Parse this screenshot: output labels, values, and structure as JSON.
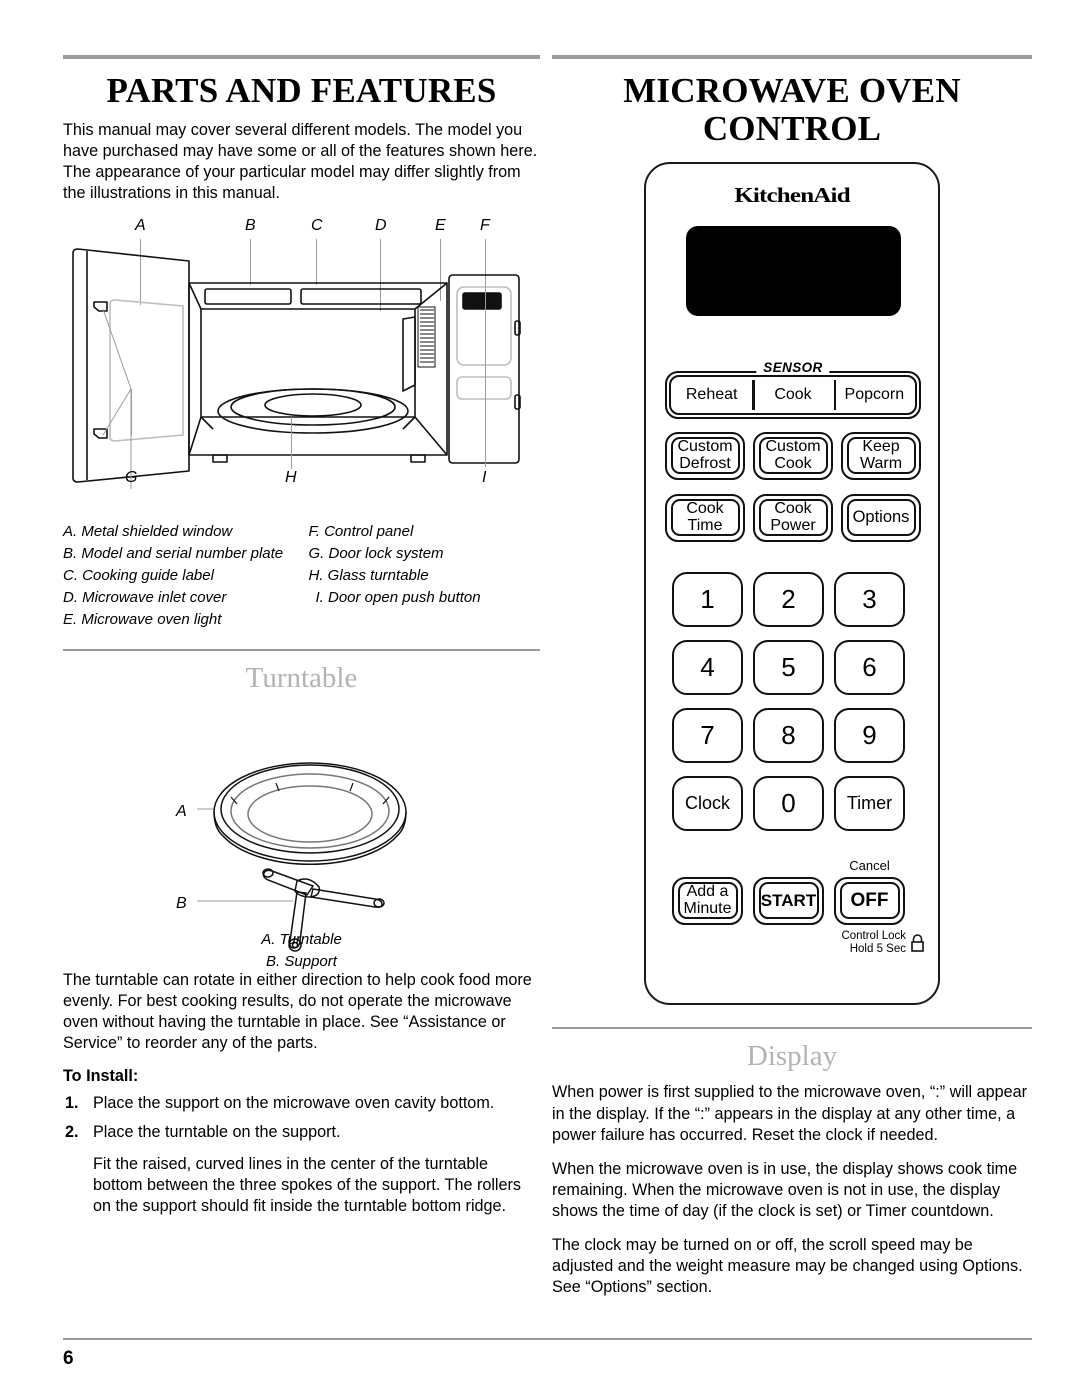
{
  "page": {
    "number": "6"
  },
  "left_column": {
    "title": "PARTS AND FEATURES",
    "intro": "This manual may cover several different models. The model you have purchased may have some or all of the features shown here. The appearance of your particular model may differ slightly from the illustrations in this manual.",
    "diagram_letters_top": [
      "A",
      "B",
      "C",
      "D",
      "E",
      "F"
    ],
    "diagram_letters_bottom": [
      "G",
      "H",
      "I"
    ],
    "legend_left": [
      "A. Metal shielded window",
      "B. Model and serial number plate",
      "C. Cooking guide label",
      "D. Microwave inlet cover",
      "E. Microwave oven light"
    ],
    "legend_right": [
      "F. Control panel",
      "G. Door lock system",
      "H. Glass turntable",
      "I. Door open push button"
    ],
    "turntable": {
      "heading": "Turntable",
      "letters": [
        "A",
        "B"
      ],
      "caption": [
        "A. Turntable",
        "B. Support"
      ],
      "paragraph": "The turntable can rotate in either direction to help cook food more evenly. For best cooking results, do not operate the microwave oven without having the turntable in place. See “Assistance or Service” to reorder any of the parts.",
      "install_heading": "To Install:",
      "steps": [
        {
          "num": "1.",
          "text": "Place the support on the microwave oven cavity bottom."
        },
        {
          "num": "2.",
          "text": "Place the turntable on the support."
        }
      ],
      "step_note": "Fit the raised, curved lines in the center of the turntable bottom between the three spokes of the support. The rollers on the support should fit inside the turntable bottom ridge."
    }
  },
  "right_column": {
    "title": "MICROWAVE OVEN CONTROL",
    "control_panel": {
      "brand": "KitchenAid",
      "sensor_label": "SENSOR",
      "sensor_buttons": [
        "Reheat",
        "Cook",
        "Popcorn"
      ],
      "function_rows": [
        [
          {
            "lines": [
              "Custom",
              "Defrost"
            ]
          },
          {
            "lines": [
              "Custom",
              "Cook"
            ]
          },
          {
            "lines": [
              "Keep",
              "Warm"
            ]
          }
        ],
        [
          {
            "lines": [
              "Cook",
              "Time"
            ]
          },
          {
            "lines": [
              "Cook",
              "Power"
            ]
          },
          {
            "lines": [
              "Options"
            ]
          }
        ]
      ],
      "keypad": [
        [
          "1",
          "2",
          "3"
        ],
        [
          "4",
          "5",
          "6"
        ],
        [
          "7",
          "8",
          "9"
        ],
        [
          "Clock",
          "0",
          "Timer"
        ]
      ],
      "bottom_row": [
        "Add a Minute",
        "START",
        "OFF"
      ],
      "add_minute_lines": [
        "Add a",
        "Minute"
      ],
      "start_label": "START",
      "off_label": "OFF",
      "cancel_label": "Cancel",
      "control_lock_line1": "Control Lock",
      "control_lock_line2": "Hold 5 Sec",
      "lock_icon": "padlock-icon"
    },
    "display": {
      "heading": "Display",
      "paragraphs": [
        "When power is first supplied to the microwave oven, “:” will appear in the display. If the “:” appears in the display at any other time, a power failure has occurred. Reset the clock if needed.",
        "When the microwave oven is in use, the display shows cook time remaining. When the microwave oven is not in use, the display shows the time of day (if the clock is set) or Timer countdown.",
        "The clock may be turned on or off, the scroll speed may be adjusted and the weight measure may be changed using Options. See “Options” section."
      ]
    }
  },
  "colors": {
    "rule_gray": "#9a9a9a",
    "heading_gray": "#b3b3b3",
    "ink": "#111111",
    "display_black": "#000000"
  }
}
